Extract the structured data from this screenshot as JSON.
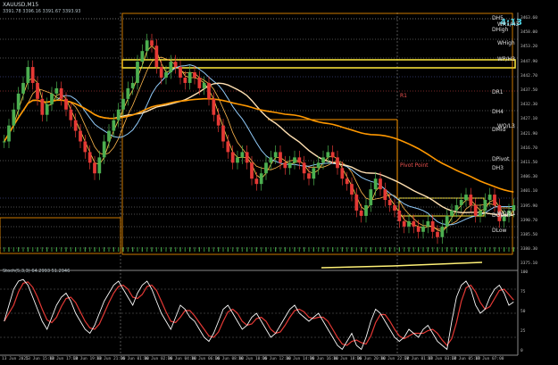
{
  "window": {
    "symbol_title": "XAUUSD,M15",
    "ohlc": "3391.78 3396.16 3391.67 3393.93",
    "countdown": "4:13"
  },
  "oscillator": {
    "label": "Stoch(5,3,3) 64.2993 51.2946",
    "ticks": [
      "100",
      "75",
      "50",
      "25",
      "0"
    ]
  },
  "level_labels": [
    {
      "text": "DH5",
      "color": "#e0e0e0"
    },
    {
      "text": "WR1/H3",
      "color": "#e0e0e0"
    },
    {
      "text": "DHigh",
      "color": "#e0e0e0"
    },
    {
      "text": "WHigh",
      "color": "#e0e0e0"
    },
    {
      "text": "WP/H3",
      "color": "#e0e0e0"
    },
    {
      "text": "DR1",
      "color": "#e0e0e0"
    },
    {
      "text": "DH4",
      "color": "#e0e0e0"
    },
    {
      "text": "WO/L3",
      "color": "#e0e0e0"
    },
    {
      "text": "DMid",
      "color": "#e0e0e0"
    },
    {
      "text": "DPivot",
      "color": "#e0e0e0"
    },
    {
      "text": "DH3",
      "color": "#e0e0e0"
    },
    {
      "text": "DOpen",
      "color": "#e0e0e0"
    },
    {
      "text": "WO/S1",
      "color": "#e0e0e0"
    },
    {
      "text": "DLow",
      "color": "#e0e0e0"
    },
    {
      "text": "Pivot Point",
      "color": "#ef5350"
    },
    {
      "text": "R1",
      "color": "#ef5350"
    }
  ],
  "chart_data": {
    "type": "candlestick",
    "title": "XAUUSD,M15",
    "ylim": [
      3370.5,
      3466.5
    ],
    "price_ticks": [
      "3463.60",
      "3458.00",
      "3453.20",
      "3447.90",
      "3442.70",
      "3437.50",
      "3432.30",
      "3427.10",
      "3421.90",
      "3416.70",
      "3411.50",
      "3406.30",
      "3401.10",
      "3395.90",
      "3390.70",
      "3385.50",
      "3380.30",
      "3375.10"
    ],
    "time_ticks": [
      "13 Jun 2025",
      "13 Jun 15:00",
      "13 Jun 17:00",
      "13 Jun 19:00",
      "13 Jun 21:00",
      "16 Jun 01:00",
      "16 Jun 02:00",
      "16 Jun 04:00",
      "16 Jun 06:00",
      "16 Jun 08:00",
      "16 Jun 10:00",
      "16 Jun 12:00",
      "16 Jun 14:00",
      "16 Jun 16:00",
      "16 Jun 18:00",
      "16 Jun 20:00",
      "16 Jun 22:00",
      "17 Jun 01:00",
      "17 Jun 03:00",
      "17 Jun 05:00",
      "17 Jun 07:00"
    ],
    "close": [
      3418,
      3424,
      3430,
      3436,
      3440,
      3446,
      3440,
      3434,
      3428,
      3432,
      3436,
      3438,
      3434,
      3430,
      3426,
      3422,
      3418,
      3414,
      3410,
      3406,
      3412,
      3418,
      3422,
      3426,
      3430,
      3434,
      3438,
      3440,
      3448,
      3452,
      3456,
      3454,
      3446,
      3442,
      3444,
      3448,
      3446,
      3442,
      3440,
      3444,
      3442,
      3438,
      3440,
      3434,
      3428,
      3424,
      3418,
      3414,
      3410,
      3412,
      3414,
      3410,
      3404,
      3402,
      3406,
      3410,
      3412,
      3414,
      3410,
      3408,
      3410,
      3412,
      3410,
      3406,
      3404,
      3408,
      3410,
      3412,
      3414,
      3412,
      3408,
      3404,
      3402,
      3398,
      3392,
      3390,
      3394,
      3400,
      3404,
      3400,
      3396,
      3394,
      3392,
      3388,
      3386,
      3388,
      3386,
      3384,
      3386,
      3388,
      3384,
      3382,
      3386,
      3390,
      3392,
      3394,
      3396,
      3398,
      3394,
      3390,
      3392,
      3396,
      3398,
      3394,
      3388,
      3390,
      3392,
      3394
    ],
    "stochastic_k": [
      40,
      60,
      80,
      90,
      92,
      85,
      70,
      55,
      40,
      30,
      45,
      60,
      70,
      75,
      65,
      50,
      40,
      30,
      25,
      35,
      50,
      65,
      75,
      85,
      90,
      80,
      70,
      60,
      75,
      85,
      90,
      80,
      65,
      50,
      40,
      30,
      45,
      60,
      55,
      45,
      40,
      30,
      20,
      15,
      25,
      40,
      55,
      60,
      50,
      40,
      30,
      35,
      45,
      50,
      40,
      30,
      20,
      25,
      35,
      45,
      55,
      60,
      50,
      45,
      40,
      45,
      50,
      40,
      30,
      20,
      10,
      5,
      15,
      25,
      10,
      5,
      20,
      40,
      55,
      50,
      40,
      30,
      20,
      15,
      20,
      30,
      25,
      20,
      30,
      35,
      25,
      15,
      10,
      5,
      40,
      70,
      85,
      90,
      80,
      60,
      50,
      55,
      70,
      80,
      85,
      75,
      60,
      64
    ]
  }
}
